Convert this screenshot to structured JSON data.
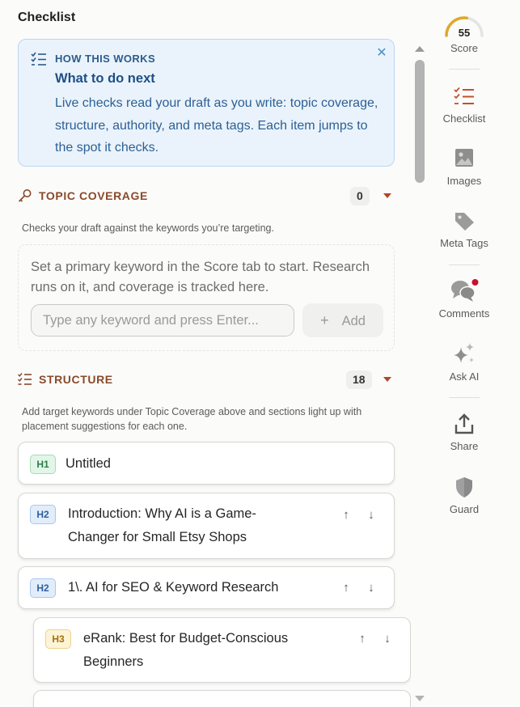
{
  "panel": {
    "title": "Checklist"
  },
  "info": {
    "kicker": "HOW THIS WORKS",
    "heading": "What to do next",
    "body": "Live checks read your draft as you write: topic coverage, structure, authority, and meta tags. Each item jumps to the spot it checks.",
    "close_glyph": "✕"
  },
  "topic_coverage": {
    "label": "TOPIC COVERAGE",
    "count": "0",
    "helper": "Checks your draft against the keywords you’re targeting.",
    "empty_text": "Set a primary keyword in the Score tab to start. Research runs on it, and coverage is tracked here.",
    "input_placeholder": "Type any keyword and press Enter...",
    "add_label": "Add",
    "add_glyph": "+"
  },
  "structure": {
    "label": "STRUCTURE",
    "count": "18",
    "helper": "Add target keywords under Topic Coverage above and sections light up with placement suggestions for each one.",
    "headings": [
      {
        "level": "H1",
        "text": "Untitled"
      },
      {
        "level": "H2",
        "text": "Introduction: Why AI is a Game-Changer for Small Etsy Shops"
      },
      {
        "level": "H2",
        "text": "1\\. AI for SEO & Keyword Research"
      },
      {
        "level": "H3",
        "text": "eRank: Best for Budget-Conscious Beginners"
      }
    ],
    "up_glyph": "↑",
    "down_glyph": "↓"
  },
  "rail": {
    "score": {
      "value": "55",
      "label": "Score",
      "fraction": 0.55
    },
    "items": [
      {
        "label": "Checklist",
        "icon": "checklist-icon"
      },
      {
        "label": "Images",
        "icon": "image-icon"
      },
      {
        "label": "Meta Tags",
        "icon": "tag-icon"
      },
      {
        "label": "Comments",
        "icon": "comments-icon"
      },
      {
        "label": "Ask AI",
        "icon": "sparkle-icon"
      },
      {
        "label": "Share",
        "icon": "share-icon"
      },
      {
        "label": "Guard",
        "icon": "shield-icon"
      }
    ]
  },
  "colors": {
    "accent": "#b0462a",
    "score_arc": "#e0a92a",
    "info_bg": "#eaf3fb",
    "info_text": "#2c5f95",
    "notification_dot": "#c8102e"
  }
}
